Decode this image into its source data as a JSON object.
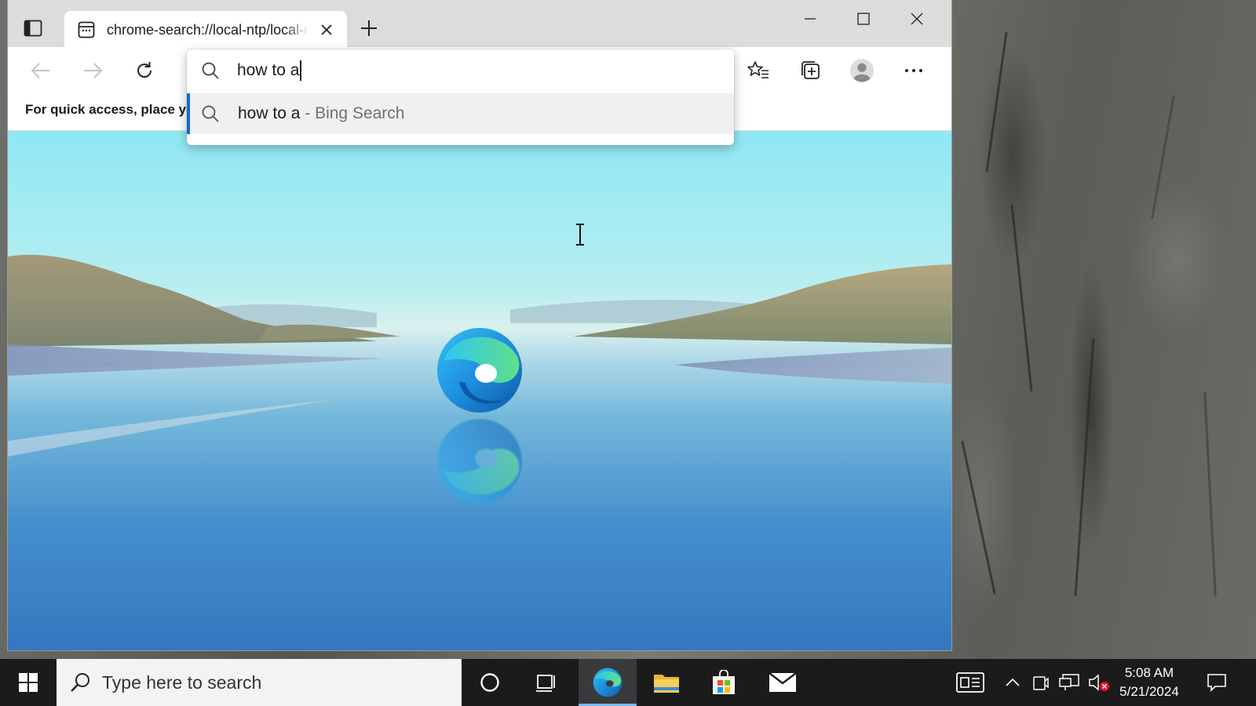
{
  "browser": {
    "tab": {
      "title": "chrome-search://local-ntp/local-ntp.html"
    },
    "favorites_bar": {
      "text": "For quick access, place your favorites here on the favorites bar."
    },
    "omnibox": {
      "input_value": "how to a",
      "suggestions": [
        {
          "query": "how to a",
          "separator": "-",
          "source": "Bing Search"
        }
      ]
    }
  },
  "taskbar": {
    "search_placeholder": "Type here to search",
    "clock": {
      "time": "5:08 AM",
      "date": "5/21/2024"
    }
  },
  "colors": {
    "accent": "#1a66d2",
    "taskbar": "#1b1b1c",
    "suggestion_highlight": "#f0f0f0"
  }
}
